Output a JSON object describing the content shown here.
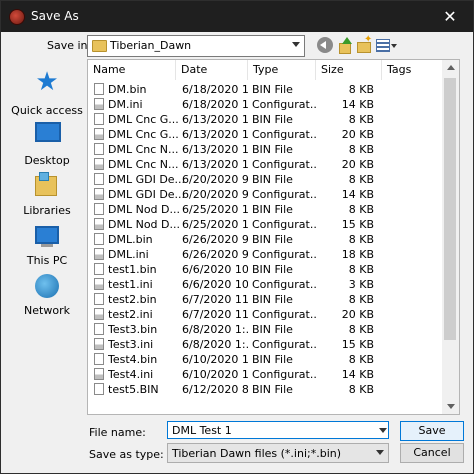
{
  "window": {
    "title": "Save As"
  },
  "toolbar": {
    "save_in_label": "Save in:",
    "current_folder": "Tiberian_Dawn"
  },
  "places": [
    {
      "label": "Quick access"
    },
    {
      "label": "Desktop"
    },
    {
      "label": "Libraries"
    },
    {
      "label": "This PC"
    },
    {
      "label": "Network"
    }
  ],
  "columns": {
    "name": "Name",
    "date": "Date",
    "type": "Type",
    "size": "Size",
    "tags": "Tags"
  },
  "files": [
    {
      "name": "DM.bin",
      "date": "6/18/2020 1...",
      "type": "BIN File",
      "size": "8 KB",
      "kind": "bin"
    },
    {
      "name": "DM.ini",
      "date": "6/18/2020 1...",
      "type": "Configurat...",
      "size": "14 KB",
      "kind": "cfg"
    },
    {
      "name": "DML Cnc G...",
      "date": "6/13/2020 1...",
      "type": "BIN File",
      "size": "8 KB",
      "kind": "bin"
    },
    {
      "name": "DML Cnc G...",
      "date": "6/13/2020 1...",
      "type": "Configurat...",
      "size": "20 KB",
      "kind": "cfg"
    },
    {
      "name": "DML Cnc N...",
      "date": "6/13/2020 1...",
      "type": "BIN File",
      "size": "8 KB",
      "kind": "bin"
    },
    {
      "name": "DML Cnc N...",
      "date": "6/13/2020 1...",
      "type": "Configurat...",
      "size": "20 KB",
      "kind": "cfg"
    },
    {
      "name": "DML GDI De...",
      "date": "6/20/2020 9...",
      "type": "BIN File",
      "size": "8 KB",
      "kind": "bin"
    },
    {
      "name": "DML GDI De...",
      "date": "6/20/2020 9...",
      "type": "Configurat...",
      "size": "14 KB",
      "kind": "cfg"
    },
    {
      "name": "DML Nod D...",
      "date": "6/25/2020 1...",
      "type": "BIN File",
      "size": "8 KB",
      "kind": "bin"
    },
    {
      "name": "DML Nod D...",
      "date": "6/25/2020 1...",
      "type": "Configurat...",
      "size": "15 KB",
      "kind": "cfg"
    },
    {
      "name": "DML.bin",
      "date": "6/26/2020 9...",
      "type": "BIN File",
      "size": "8 KB",
      "kind": "bin"
    },
    {
      "name": "DML.ini",
      "date": "6/26/2020 9...",
      "type": "Configurat...",
      "size": "18 KB",
      "kind": "cfg"
    },
    {
      "name": "test1.bin",
      "date": "6/6/2020 10:...",
      "type": "BIN File",
      "size": "8 KB",
      "kind": "bin"
    },
    {
      "name": "test1.ini",
      "date": "6/6/2020 10:...",
      "type": "Configurat...",
      "size": "3 KB",
      "kind": "cfg"
    },
    {
      "name": "test2.bin",
      "date": "6/7/2020 11:...",
      "type": "BIN File",
      "size": "8 KB",
      "kind": "bin"
    },
    {
      "name": "test2.ini",
      "date": "6/7/2020 11:...",
      "type": "Configurat...",
      "size": "20 KB",
      "kind": "cfg"
    },
    {
      "name": "Test3.bin",
      "date": "6/8/2020 1:...",
      "type": "BIN File",
      "size": "8 KB",
      "kind": "bin"
    },
    {
      "name": "Test3.ini",
      "date": "6/8/2020 1:...",
      "type": "Configurat...",
      "size": "15 KB",
      "kind": "cfg"
    },
    {
      "name": "Test4.bin",
      "date": "6/10/2020 1...",
      "type": "BIN File",
      "size": "8 KB",
      "kind": "bin"
    },
    {
      "name": "Test4.ini",
      "date": "6/10/2020 1...",
      "type": "Configurat...",
      "size": "14 KB",
      "kind": "cfg"
    },
    {
      "name": "test5.BIN",
      "date": "6/12/2020 8...",
      "type": "BIN File",
      "size": "8 KB",
      "kind": "bin"
    }
  ],
  "footer": {
    "file_name_label": "File name:",
    "file_name_value": "DML Test 1",
    "save_as_type_label": "Save as type:",
    "save_as_type_value": "Tiberian Dawn files (*.ini;*.bin)",
    "save_label": "Save",
    "cancel_label": "Cancel"
  },
  "colors": {
    "accent": "#0078d7",
    "titlebar": "#1f1f1f"
  }
}
